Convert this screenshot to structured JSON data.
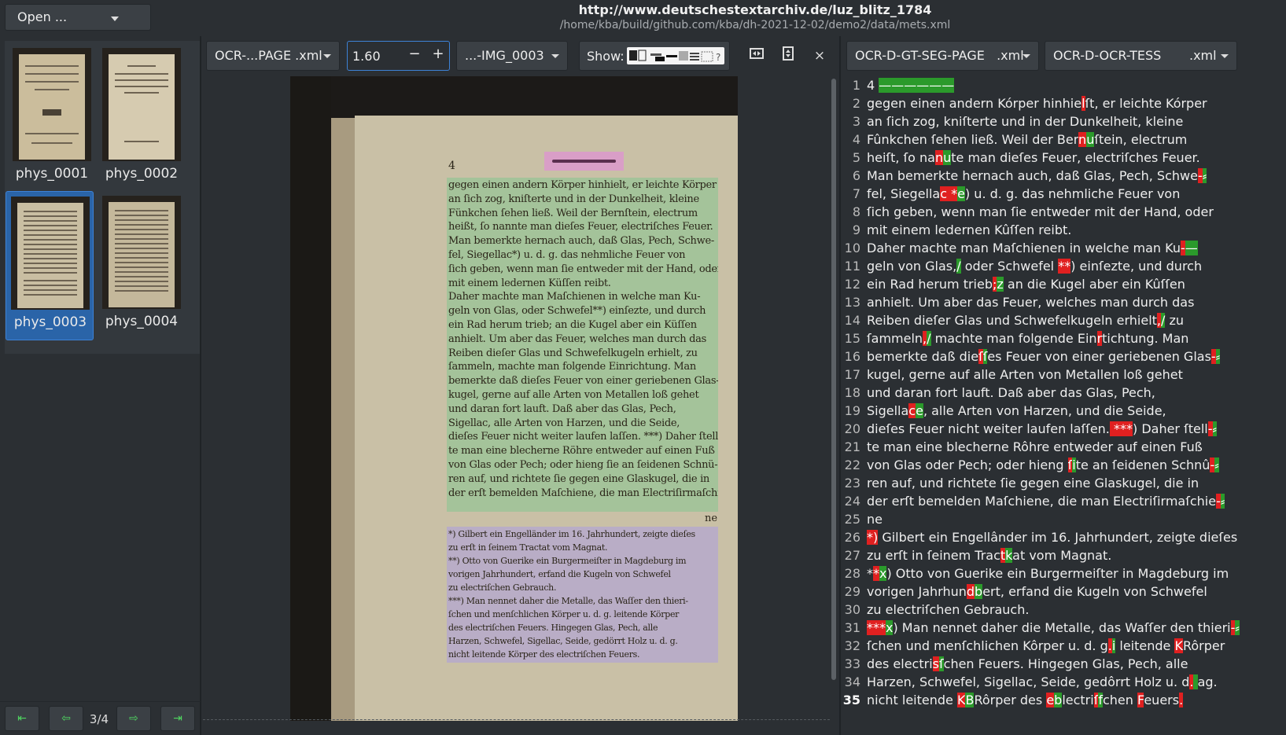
{
  "header": {
    "open_label": "Open ...",
    "title": "http://www.deutschestextarchiv.de/luz_blitz_1784",
    "path": "/home/kba/build/github.com/kba/dh-2021-12-02/demo2/data/mets.xml"
  },
  "thumbnails": [
    {
      "label": "phys_0001",
      "selected": false
    },
    {
      "label": "phys_0002",
      "selected": false
    },
    {
      "label": "phys_0003",
      "selected": true
    },
    {
      "label": "phys_0004",
      "selected": false
    }
  ],
  "nav": {
    "first": "⇤",
    "prev": "⇦",
    "page_counter": "3/4",
    "next": "⇨",
    "last": "⇥"
  },
  "toolbar": {
    "left_file_group": "OCR-...PAGE",
    "left_file_ext": ".xml",
    "zoom_value": "1.60",
    "zoom_minus": "−",
    "zoom_plus": "+",
    "image_select": "...-IMG_0003",
    "show_label": "Show:",
    "close": "×",
    "right_group_a": "OCR-D-GT-SEG-PAGE",
    "right_group_a_ext": ".xml",
    "right_group_b": "OCR-D-OCR-TESS",
    "right_group_b_ext": ".xml"
  },
  "colors": {
    "accent": "#2a64a8",
    "diff_removed": "#e02020",
    "diff_added": "#2b9a2b",
    "region_text": "#78c88c",
    "region_footnote": "#afa0dc"
  },
  "scan": {
    "page_number": "4",
    "continuation": "ne",
    "lines": [
      "gegen einen andern Körper hinhielt, er leichte Körper",
      "an ſich zog, kniſterte und in der Dunkelheit, kleine",
      "Fünkchen ſehen ließ.  Weil der Bernſtein, electrum",
      "heißt, ſo nannte man dieſes Feuer, electriſches Feuer.",
      "Man bemerkte hernach auch, daß Glas, Pech, Schwe-",
      "fel, Siegellac*) u. d. g. das nehmliche Feuer von",
      "ſich geben, wenn man ſie entweder mit der Hand, oder",
      "mit einem ledernen Küſſen reibt.",
      "Daher machte man Maſchienen in welche man Ku-",
      "geln von Glas, oder Schwefel**) einſezte, und durch",
      "ein Rad herum trieb; an die Kugel aber ein Küſſen",
      "anhielt.  Um aber das Feuer, welches man durch das",
      "Reiben dieſer Glas und Schwefelkugeln erhielt, zu",
      "ſammeln, machte man folgende Einrichtung.  Man",
      "bemerkte daß dieſes Feuer von einer geriebenen Glas-",
      "kugel, gerne auf alle Arten von Metallen loß gehet",
      "und daran fort lauft.  Daß aber das Glas, Pech,",
      "Sigellac, alle Arten von Harzen, und die Seide,",
      "dieſes Feuer nicht weiter laufen laſſen. ***)  Daher ſtell-",
      "te man eine blecherne Röhre entweder auf einen Fuß",
      "von Glas oder Pech; oder hieng ſie an ſeidenen Schnü-",
      "ren auf, und richtete ſie gegen eine Glaskugel, die in",
      "der erſt bemelden Maſchiene, die man Electriſirmaſchie-"
    ],
    "footnotes": [
      "*) Gilbert ein Engelländer im 16. Jahrhundert, zeigte dieſes",
      "zu erſt in ſeinem Tractat vom Magnat.",
      "**) Otto von Guerike ein Burgermeiſter in Magdeburg im",
      "vorigen Jahrhundert, erfand die Kugeln von Schwefel",
      "zu electriſchen Gebrauch.",
      "***) Man nennet daher die Metalle, das Waſſer den thieri-",
      "ſchen und menſchlichen Körper u. d. g. leitende Körper",
      "des electriſchen Feuers.  Hingegen Glas, Pech, alle",
      "Harzen, Schwefel, Sigellac, Seide, gedörrt Holz u. d. g.",
      "nicht leitende Körper des electriſchen Feuers."
    ]
  },
  "text_lines": [
    {
      "n": "1",
      "segs": [
        [
          "",
          "4 "
        ],
        [
          "g",
          "——————"
        ]
      ]
    },
    {
      "n": "2",
      "segs": [
        [
          "",
          "gegen einen andern Kórper hinhie"
        ],
        [
          "r",
          "l"
        ],
        [
          "",
          "ſt, er leichte Kórper"
        ]
      ]
    },
    {
      "n": "3",
      "segs": [
        [
          "",
          "an ſich zog, kniſterte und in der Dunkelheit, kleine"
        ]
      ]
    },
    {
      "n": "4",
      "segs": [
        [
          "",
          "Fûnkchen ſehen ließ. Weil der Ber"
        ],
        [
          "r",
          "n"
        ],
        [
          "g",
          "u"
        ],
        [
          "",
          "ſtein, electrum"
        ]
      ]
    },
    {
      "n": "5",
      "segs": [
        [
          "",
          "heiſt, ſo na"
        ],
        [
          "r",
          "n"
        ],
        [
          "g",
          "u"
        ],
        [
          "",
          "te man dieſes Feuer, electriſches Feuer."
        ]
      ]
    },
    {
      "n": "6",
      "segs": [
        [
          "",
          "Man bemerkte hernach auch, daß Glas, Pech, Schwe"
        ],
        [
          "r",
          "-"
        ],
        [
          "g",
          "⸗"
        ]
      ]
    },
    {
      "n": "7",
      "segs": [
        [
          "",
          "fel, Siegella"
        ],
        [
          "r",
          "c *"
        ],
        [
          "g",
          "e"
        ],
        [
          "",
          ") u. d. g. das nehmliche Feuer von"
        ]
      ]
    },
    {
      "n": "8",
      "segs": [
        [
          "",
          "ſich geben, wenn man ſie entweder mit der Hand, oder"
        ]
      ]
    },
    {
      "n": "9",
      "segs": [
        [
          "",
          "mit einem ledernen Kûſſen reibt."
        ]
      ]
    },
    {
      "n": "10",
      "segs": [
        [
          "",
          "Daher machte man Maſchienen in welche man Ku"
        ],
        [
          "r",
          "-"
        ],
        [
          "g",
          "—"
        ]
      ]
    },
    {
      "n": "11",
      "segs": [
        [
          "",
          "geln von Glas,"
        ],
        [
          "g",
          "/"
        ],
        [
          "",
          " oder Schwefel "
        ],
        [
          "r",
          "**"
        ],
        [
          "",
          ") einſezte, und durch"
        ]
      ]
    },
    {
      "n": "12",
      "segs": [
        [
          "",
          "ein Rad herum trieb"
        ],
        [
          "r",
          ";"
        ],
        [
          "g",
          "z"
        ],
        [
          "",
          " an die Kugel aber ein Kûſſen"
        ]
      ]
    },
    {
      "n": "13",
      "segs": [
        [
          "",
          "anhielt. Um aber das Feuer, welches man durch das"
        ]
      ]
    },
    {
      "n": "14",
      "segs": [
        [
          "",
          "Reiben dieſer Glas und Schwefelkugeln erhielt"
        ],
        [
          "r",
          ","
        ],
        [
          "g",
          "/"
        ],
        [
          "",
          " zu"
        ]
      ]
    },
    {
      "n": "15",
      "segs": [
        [
          "",
          "ſammeln"
        ],
        [
          "r",
          ","
        ],
        [
          "g",
          "/"
        ],
        [
          "",
          " machte man folgende Ein"
        ],
        [
          "r",
          "r"
        ],
        [
          "",
          "tichtung. Man"
        ]
      ]
    },
    {
      "n": "16",
      "segs": [
        [
          "",
          "bemerkte daß die"
        ],
        [
          "r",
          "ſ"
        ],
        [
          "g",
          "ſ"
        ],
        [
          "",
          "es Feuer von einer geriebenen Glas"
        ],
        [
          "r",
          "-"
        ],
        [
          "g",
          "⸗"
        ]
      ]
    },
    {
      "n": "17",
      "segs": [
        [
          "",
          "kugel, gerne auf alle Arten von Metallen loß gehet"
        ]
      ]
    },
    {
      "n": "18",
      "segs": [
        [
          "",
          "und daran fort lauft. Daß aber das Glas, Pech,"
        ]
      ]
    },
    {
      "n": "19",
      "segs": [
        [
          "",
          "Sigella"
        ],
        [
          "r",
          "c"
        ],
        [
          "g",
          "e"
        ],
        [
          "",
          ", alle Arten von Harzen, und die Seide,"
        ]
      ]
    },
    {
      "n": "20",
      "segs": [
        [
          "",
          "dieſes Feuer nicht weiter laufen laſſen."
        ],
        [
          "r",
          " ***"
        ],
        [
          "",
          ") Daher ſtell"
        ],
        [
          "r",
          "-"
        ],
        [
          "g",
          "⸗"
        ]
      ]
    },
    {
      "n": "21",
      "segs": [
        [
          "",
          "te man eine blecherne Rôhre entweder auf einen Fuß"
        ]
      ]
    },
    {
      "n": "22",
      "segs": [
        [
          "",
          "von Glas oder Pech; oder hieng "
        ],
        [
          "r",
          "ſ"
        ],
        [
          "g",
          "i"
        ],
        [
          "",
          "te an ſeidenen Schnû"
        ],
        [
          "r",
          "-"
        ],
        [
          "g",
          "⸗"
        ]
      ]
    },
    {
      "n": "23",
      "segs": [
        [
          "",
          "ren auf, und richtete ſie gegen eine Glaskugel, die in"
        ]
      ]
    },
    {
      "n": "24",
      "segs": [
        [
          "",
          "der erſt bemelden Maſchiene, die man Electriſirmaſchie"
        ],
        [
          "r",
          "-"
        ],
        [
          "g",
          "⸗"
        ]
      ]
    },
    {
      "n": "25",
      "segs": [
        [
          "",
          "ne"
        ]
      ]
    },
    {
      "n": "26",
      "segs": [
        [
          "r",
          "*)"
        ],
        [
          "",
          " Gilbert ein Engellânder im 16. Jahrhundert, zeigte dieſes"
        ]
      ]
    },
    {
      "n": "27",
      "segs": [
        [
          "",
          "zu erſt in ſeinem Trac"
        ],
        [
          "r",
          "t"
        ],
        [
          "g",
          "k"
        ],
        [
          "",
          "at vom Magnat."
        ]
      ]
    },
    {
      "n": "28",
      "segs": [
        [
          "",
          "*"
        ],
        [
          "r",
          "*"
        ],
        [
          "g",
          "x"
        ],
        [
          "",
          ") Otto von Guerike ein Burgermeiſter in Magdeburg im"
        ]
      ]
    },
    {
      "n": "29",
      "segs": [
        [
          "",
          "vorigen Jahrhun"
        ],
        [
          "r",
          "d"
        ],
        [
          "g",
          "b"
        ],
        [
          "",
          "ert, erfand die Kugeln von Schwefel"
        ]
      ]
    },
    {
      "n": "30",
      "segs": [
        [
          "",
          "zu electriſchen Gebrauch."
        ]
      ]
    },
    {
      "n": "31",
      "segs": [
        [
          "r",
          "***"
        ],
        [
          "g",
          "x"
        ],
        [
          "",
          ") Man nennet daher die Metalle, das Waſſer den thieri"
        ],
        [
          "r",
          "-"
        ],
        [
          "g",
          "⸗"
        ]
      ]
    },
    {
      "n": "32",
      "segs": [
        [
          "",
          "ſchen und menſchlichen Kôrper u. d. g"
        ],
        [
          "r",
          "."
        ],
        [
          "g",
          "i"
        ],
        [
          "",
          " leitende "
        ],
        [
          "r",
          "K"
        ],
        [
          "",
          "Rôrper"
        ]
      ]
    },
    {
      "n": "33",
      "segs": [
        [
          "",
          "des electri"
        ],
        [
          "r",
          "s"
        ],
        [
          "g",
          "ſ"
        ],
        [
          "",
          "chen Feuers. Hingegen Glas, Pech, alle"
        ]
      ]
    },
    {
      "n": "34",
      "segs": [
        [
          "",
          "Harzen, Schwefel, "
        ],
        [
          "r",
          " "
        ],
        [
          "",
          "Sigellac, Seide, gedôrrt Holz u. d"
        ],
        [
          "r",
          "."
        ],
        [
          "g",
          " "
        ],
        [
          "",
          "ag."
        ]
      ]
    },
    {
      "n": "35",
      "bold": true,
      "segs": [
        [
          "",
          "nicht leitende "
        ],
        [
          "r",
          "K"
        ],
        [
          "g",
          "B"
        ],
        [
          "",
          "Rôrper des "
        ],
        [
          "r",
          "e"
        ],
        [
          "g",
          "b"
        ],
        [
          "",
          "lectri"
        ],
        [
          "r",
          "ſ"
        ],
        [
          "g",
          "f"
        ],
        [
          "",
          "chen "
        ],
        [
          "r",
          "F"
        ],
        [
          "",
          "euers"
        ],
        [
          "r",
          "."
        ]
      ]
    }
  ]
}
